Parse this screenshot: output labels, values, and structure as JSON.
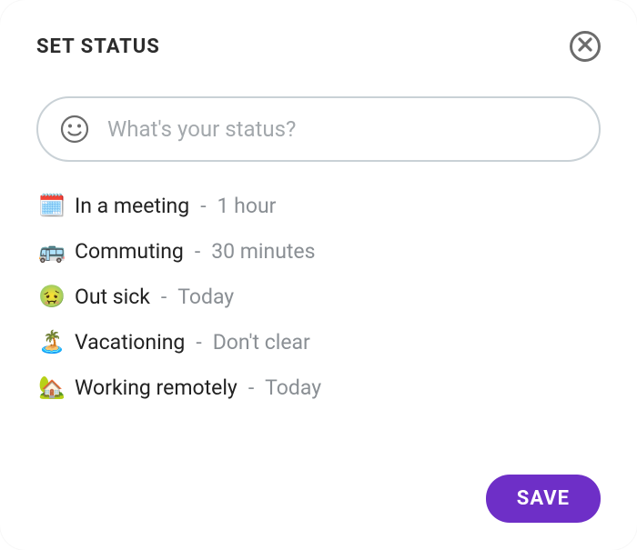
{
  "title": "SET STATUS",
  "input": {
    "placeholder": "What's your status?",
    "value": ""
  },
  "options": [
    {
      "emoji": "🗓️",
      "label": "In a meeting",
      "duration": "1 hour"
    },
    {
      "emoji": "🚌",
      "label": "Commuting",
      "duration": "30 minutes"
    },
    {
      "emoji": "🤢",
      "label": "Out sick",
      "duration": "Today"
    },
    {
      "emoji": "🏝️",
      "label": "Vacationing",
      "duration": "Don't clear"
    },
    {
      "emoji": "🏡",
      "label": "Working remotely",
      "duration": "Today"
    }
  ],
  "separator": " - ",
  "save_label": "SAVE"
}
